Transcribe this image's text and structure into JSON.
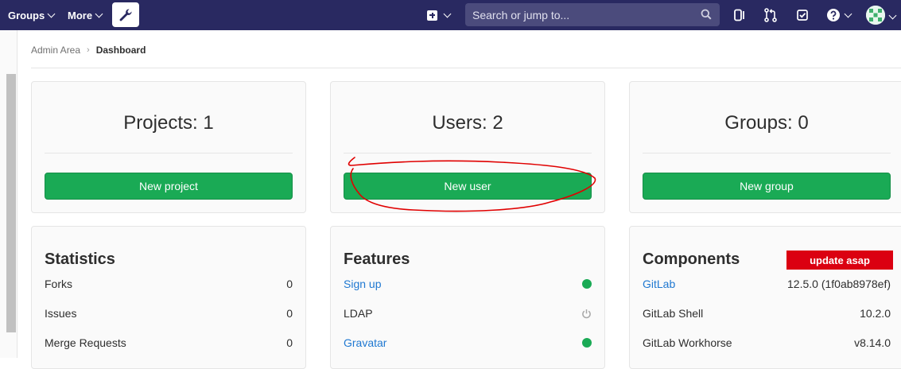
{
  "navbar": {
    "groups_label": "Groups",
    "more_label": "More",
    "search_placeholder": "Search or jump to...",
    "bg_color": "#292961"
  },
  "breadcrumb": {
    "items": [
      "Admin Area",
      "Dashboard"
    ]
  },
  "summary_cards": [
    {
      "title": "Projects: 1",
      "button": "New project"
    },
    {
      "title": "Users: 2",
      "button": "New user"
    },
    {
      "title": "Groups: 0",
      "button": "New group"
    }
  ],
  "statistics": {
    "title": "Statistics",
    "rows": [
      {
        "label": "Forks",
        "value": "0"
      },
      {
        "label": "Issues",
        "value": "0"
      },
      {
        "label": "Merge Requests",
        "value": "0"
      }
    ]
  },
  "features": {
    "title": "Features",
    "rows": [
      {
        "label": "Sign up",
        "status": "on"
      },
      {
        "label": "LDAP",
        "status": "off"
      },
      {
        "label": "Gravatar",
        "status": "on"
      }
    ]
  },
  "components": {
    "title": "Components",
    "badge": "update asap",
    "rows": [
      {
        "label": "GitLab",
        "value": "12.5.0 (1f0ab8978ef)"
      },
      {
        "label": "GitLab Shell",
        "value": "10.2.0"
      },
      {
        "label": "GitLab Workhorse",
        "value": "v8.14.0"
      }
    ]
  },
  "colors": {
    "accent_green": "#1aaa55",
    "link_blue": "#1f78d1",
    "alert_red": "#db0011",
    "annotation_red": "#e00000"
  },
  "icons": [
    "wrench-icon",
    "plus-square-icon",
    "search-icon",
    "sidebar-toggle-icon",
    "merge-request-icon",
    "todo-check-icon",
    "help-icon",
    "power-icon"
  ]
}
